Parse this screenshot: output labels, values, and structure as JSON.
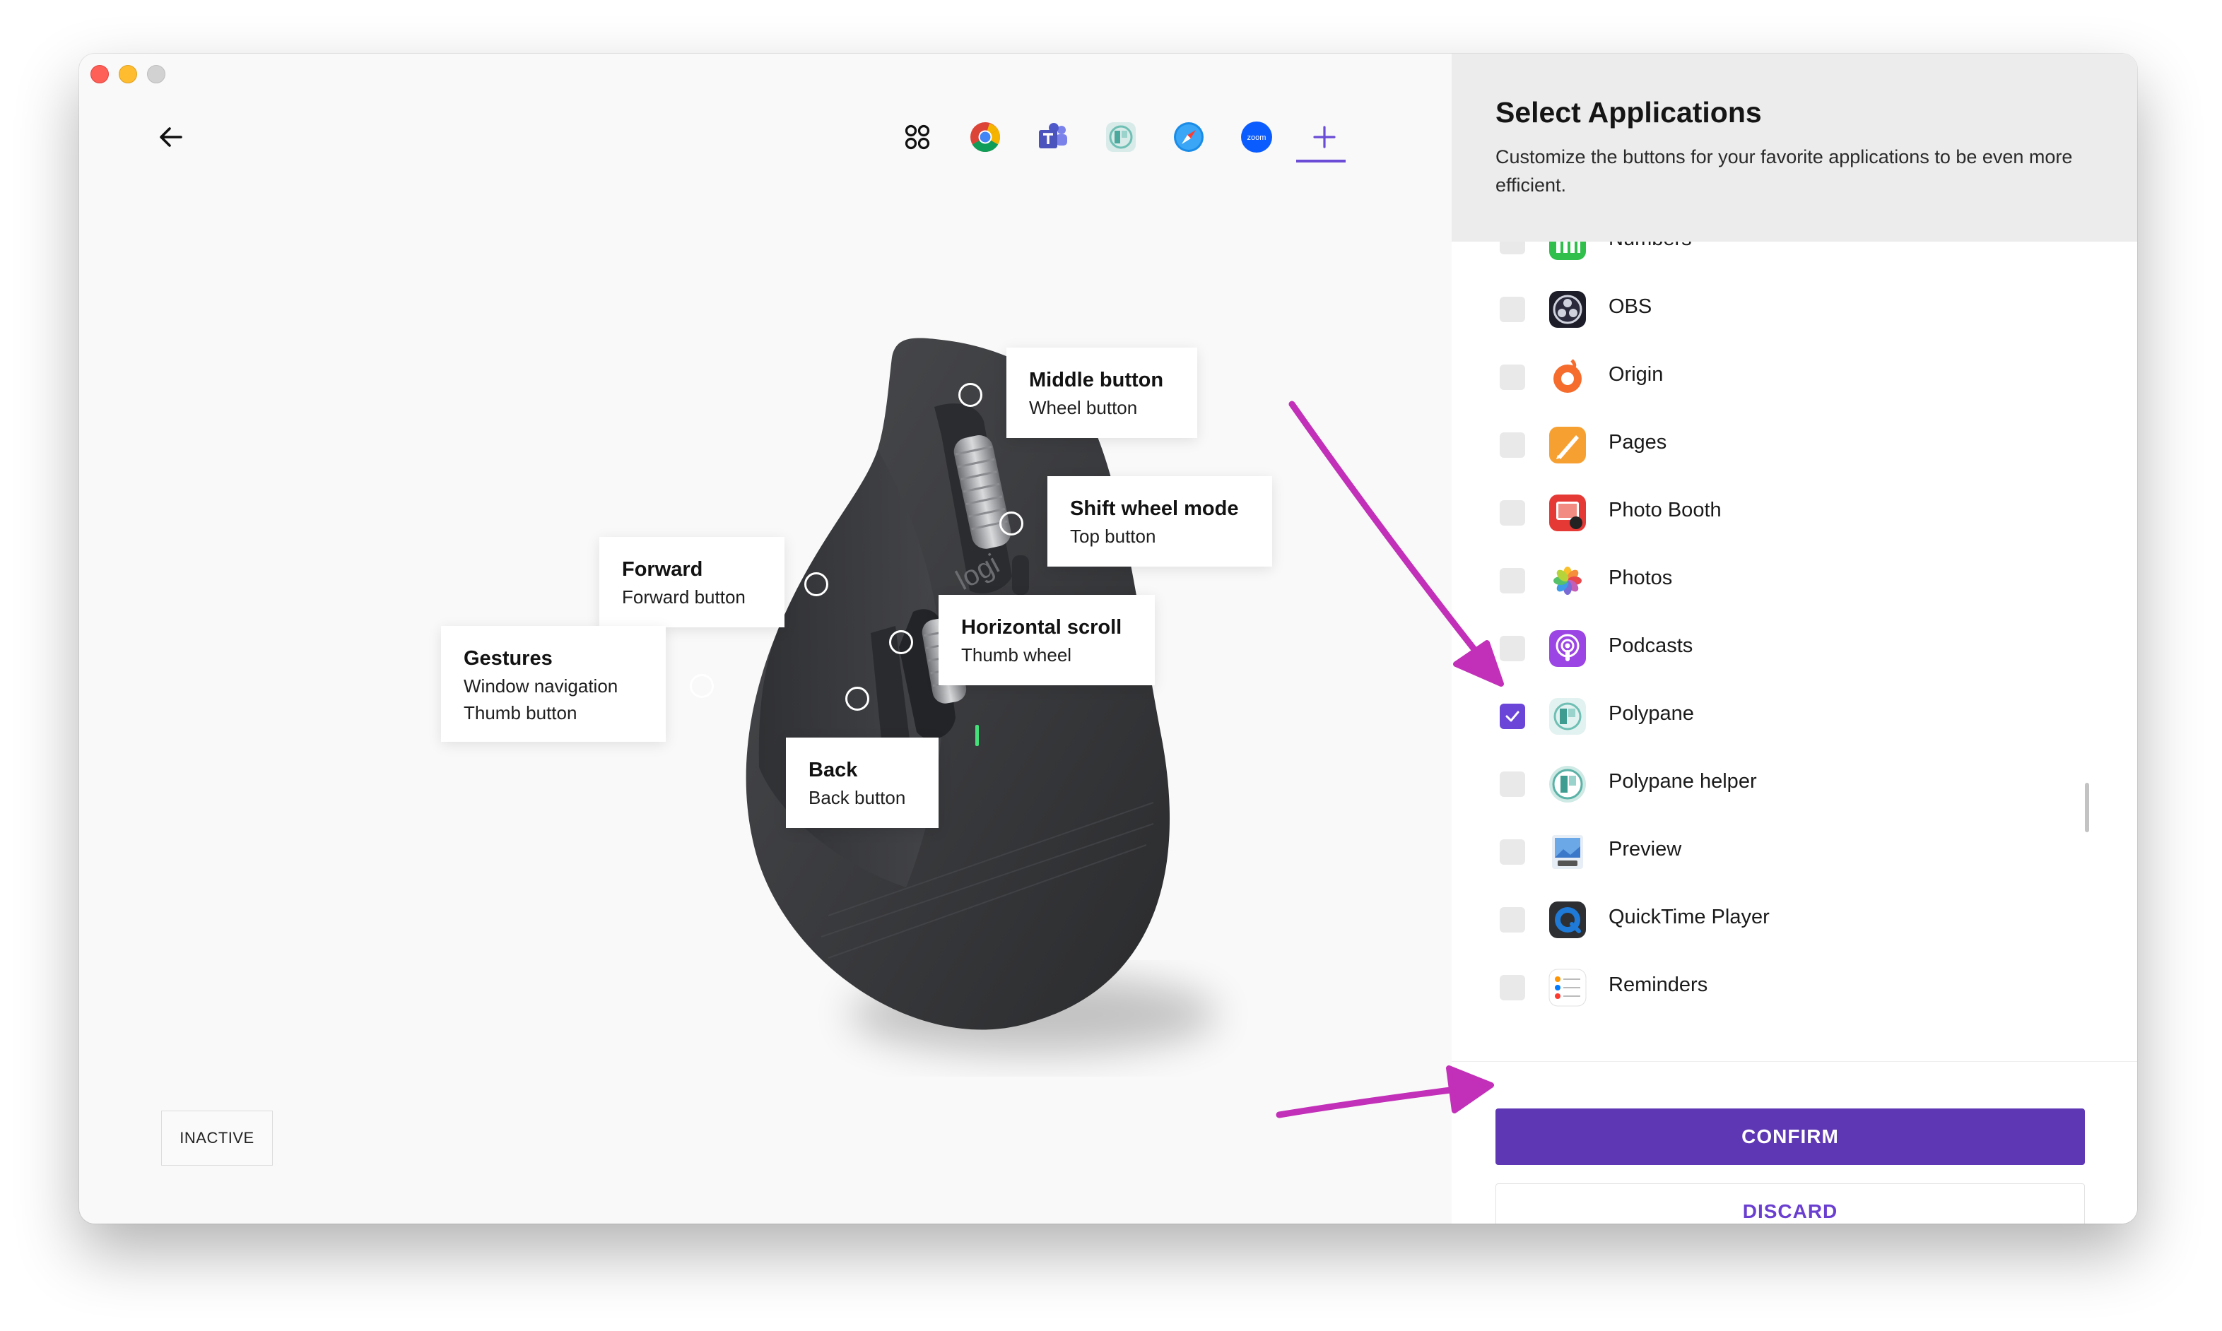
{
  "window": {
    "controls": [
      "close",
      "minimize",
      "zoom"
    ]
  },
  "toolbar": {
    "back_icon": "arrow-left-icon",
    "app_tabs": [
      {
        "name": "all-applications",
        "icon": "grid-icon"
      },
      {
        "name": "chrome",
        "icon": "chrome-icon"
      },
      {
        "name": "teams",
        "icon": "teams-icon"
      },
      {
        "name": "polypane",
        "icon": "polypane-icon"
      },
      {
        "name": "safari",
        "icon": "safari-icon"
      },
      {
        "name": "zoom",
        "icon": "zoom-icon",
        "label": "zoom"
      },
      {
        "name": "add-application",
        "icon": "plus-icon",
        "active": true
      }
    ]
  },
  "mouse": {
    "brand": "logi",
    "callouts": {
      "middle": {
        "title": "Middle button",
        "sub": "Wheel button"
      },
      "shift": {
        "title": "Shift wheel mode",
        "sub": "Top button"
      },
      "forward": {
        "title": "Forward",
        "sub": "Forward button"
      },
      "horizontal": {
        "title": "Horizontal scroll",
        "sub": "Thumb wheel"
      },
      "gestures": {
        "title": "Gestures",
        "sub1": "Window navigation",
        "sub2": "Thumb button"
      },
      "back": {
        "title": "Back",
        "sub": "Back button"
      }
    }
  },
  "status": {
    "inactive_label": "INACTIVE"
  },
  "panel": {
    "title": "Select Applications",
    "description": "Customize the buttons for your favorite applications to be even more efficient.",
    "apps": [
      {
        "name": "Numbers",
        "checked": false
      },
      {
        "name": "OBS",
        "checked": false
      },
      {
        "name": "Origin",
        "checked": false
      },
      {
        "name": "Pages",
        "checked": false
      },
      {
        "name": "Photo Booth",
        "checked": false
      },
      {
        "name": "Photos",
        "checked": false
      },
      {
        "name": "Podcasts",
        "checked": false
      },
      {
        "name": "Polypane",
        "checked": true
      },
      {
        "name": "Polypane helper",
        "checked": false
      },
      {
        "name": "Preview",
        "checked": false
      },
      {
        "name": "QuickTime Player",
        "checked": false
      },
      {
        "name": "Reminders",
        "checked": false
      }
    ],
    "confirm_label": "CONFIRM",
    "discard_label": "DISCARD"
  },
  "colors": {
    "accent": "#5e37b4",
    "checkbox_checked": "#6b45d8",
    "annotation_arrow": "#c22fb8"
  }
}
